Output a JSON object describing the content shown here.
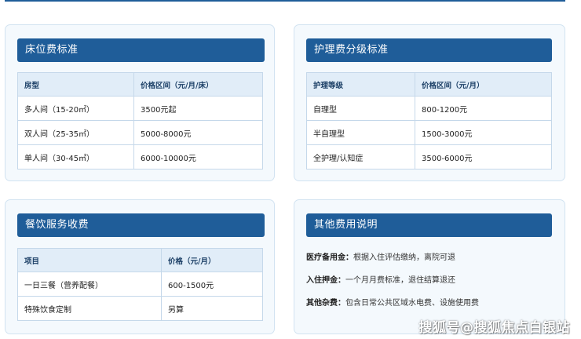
{
  "bed_fees": {
    "title": "床位费标准",
    "headers": [
      "房型",
      "价格区间（元/月/床）"
    ],
    "rows": [
      [
        "多人间（15-20㎡）",
        "3500元起"
      ],
      [
        "双人间（25-35㎡）",
        "5000-8000元"
      ],
      [
        "单人间（30-45㎡）",
        "6000-10000元"
      ]
    ]
  },
  "care_fees": {
    "title": "护理费分级标准",
    "headers": [
      "护理等级",
      "价格区间（元/月）"
    ],
    "rows": [
      [
        "自理型",
        "800-1200元"
      ],
      [
        "半自理型",
        "1500-3000元"
      ],
      [
        "全护理/认知症",
        "3500-6000元"
      ]
    ]
  },
  "meal_fees": {
    "title": "餐饮服务收费",
    "headers": [
      "项目",
      "价格（元/月）"
    ],
    "rows": [
      [
        "一日三餐（营养配餐）",
        "600-1500元"
      ],
      [
        "特殊饮食定制",
        "另算"
      ]
    ]
  },
  "other_fees": {
    "title": "其他费用说明",
    "items": [
      {
        "label": "医疗备用金：",
        "text": "根据入住评估缴纳，离院可退"
      },
      {
        "label": "入住押金：",
        "text": "一个月月费标准，退住结算退还"
      },
      {
        "label": "其他杂费：",
        "text": "包含日常公共区域水电费、设施使用费"
      }
    ]
  },
  "watermark": "搜狐号@搜狐焦点白银站",
  "colors": {
    "header_bg": "#1f5d99",
    "card_bg": "#f4f9fd",
    "table_head_bg": "#e1edf8"
  }
}
